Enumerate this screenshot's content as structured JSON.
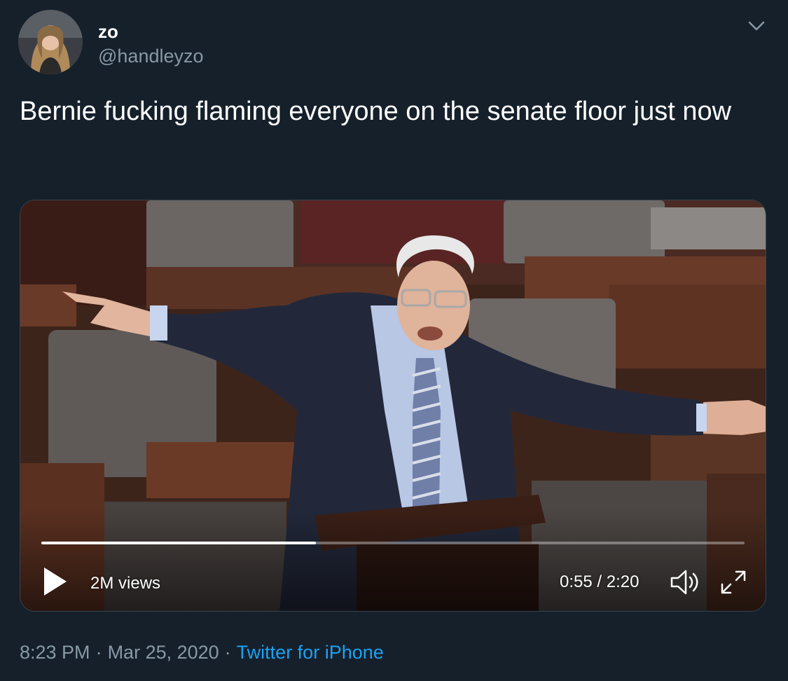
{
  "author": {
    "display_name": "zo",
    "handle": "@handleyzo",
    "avatar_icon": "profile-photo"
  },
  "tweet": {
    "text": "Bernie fucking flaming everyone on the senate floor just now"
  },
  "video": {
    "views": "2M views",
    "time": "0:55 / 2:20",
    "progress": 0.39,
    "play_icon": "play-icon",
    "volume_icon": "volume-icon",
    "fullscreen_icon": "fullscreen-icon"
  },
  "footer": {
    "time": "8:23 PM",
    "date": "Mar 25, 2020",
    "separator": "·",
    "source": "Twitter for iPhone"
  },
  "colors": {
    "background": "#15202b",
    "secondary_text": "#8899a6",
    "link": "#1da1f2"
  }
}
